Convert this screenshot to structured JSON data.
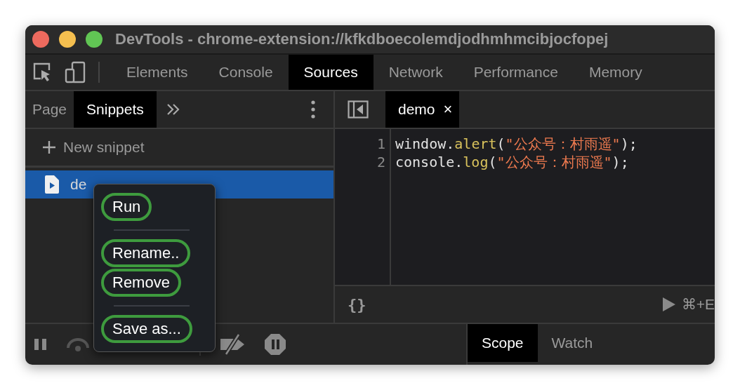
{
  "window": {
    "title": "DevTools - chrome-extension://kfkdboecolemdjodhmhmcibjocfopej"
  },
  "tabs": [
    {
      "label": "Elements",
      "selected": false
    },
    {
      "label": "Console",
      "selected": false
    },
    {
      "label": "Sources",
      "selected": true
    },
    {
      "label": "Network",
      "selected": false
    },
    {
      "label": "Performance",
      "selected": false
    },
    {
      "label": "Memory",
      "selected": false
    }
  ],
  "navigator": {
    "tabs": [
      {
        "label": "Page",
        "selected": false
      },
      {
        "label": "Snippets",
        "selected": true
      }
    ],
    "new_snippet": "New snippet",
    "snippets": [
      {
        "name": "de",
        "selected": true
      }
    ]
  },
  "context_menu": [
    {
      "kind": "item",
      "label": "Run",
      "highlighted": true
    },
    {
      "kind": "separator"
    },
    {
      "kind": "item",
      "label": "Rename..",
      "highlighted": true
    },
    {
      "kind": "item",
      "label": "Remove",
      "highlighted": true
    },
    {
      "kind": "separator"
    },
    {
      "kind": "item",
      "label": "Save as...",
      "highlighted": true
    }
  ],
  "editor": {
    "tabs": [
      {
        "label": "demo",
        "selected": true,
        "close": "×"
      }
    ],
    "lines": [
      {
        "number": "1",
        "tokens": [
          {
            "kind": "plain",
            "text": "window."
          },
          {
            "kind": "method",
            "text": "alert"
          },
          {
            "kind": "plain",
            "text": "("
          },
          {
            "kind": "string",
            "text": "\"公众号：村雨遥\""
          },
          {
            "kind": "plain",
            "text": ");"
          }
        ]
      },
      {
        "number": "2",
        "tokens": [
          {
            "kind": "plain",
            "text": "console."
          },
          {
            "kind": "method",
            "text": "log"
          },
          {
            "kind": "plain",
            "text": "("
          },
          {
            "kind": "string",
            "text": "\"公众号：村雨遥\""
          },
          {
            "kind": "plain",
            "text": ");"
          }
        ]
      }
    ],
    "status": {
      "format": "{}",
      "run_shortcut": "⌘+E"
    }
  },
  "sidebar_tabs": [
    {
      "label": "Scope",
      "selected": true
    },
    {
      "label": "Watch",
      "selected": false
    }
  ]
}
